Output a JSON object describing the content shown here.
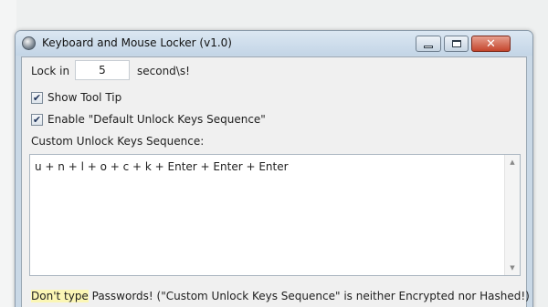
{
  "window": {
    "title": "Keyboard and Mouse Locker (v1.0)",
    "icon": "lock-app-icon"
  },
  "lock": {
    "label": "Lock in",
    "seconds_value": "5",
    "seconds_label": "second\\s!"
  },
  "options": {
    "show_tooltip": {
      "label": "Show Tool Tip",
      "checked": true
    },
    "default_unlock": {
      "label": "Enable \"Default Unlock Keys Sequence\"",
      "checked": true
    }
  },
  "custom_sequence": {
    "label": "Custom Unlock Keys Sequence:",
    "value": "u + n + l + o + c + k + Enter + Enter + Enter"
  },
  "warning": {
    "prefix": "Don't type",
    "rest": " Passwords! (\"Custom Unlock Keys Sequence\" is neither Encrypted nor Hashed!)"
  },
  "colors": {
    "titlebar": "#c3d5e6",
    "close_button": "#c4452c",
    "client_bg": "#f0f0f0"
  }
}
